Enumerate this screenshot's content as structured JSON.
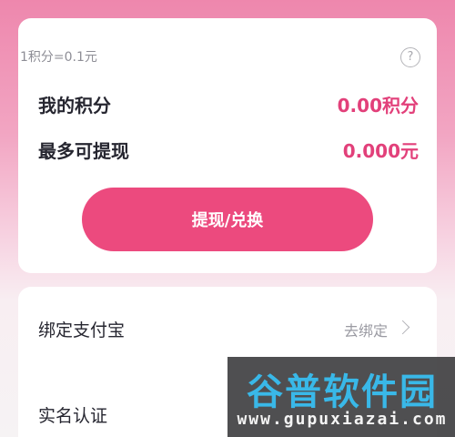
{
  "points_card": {
    "rate_text": "1积分=0.1元",
    "help_icon_glyph": "?",
    "my_points": {
      "label": "我的积分",
      "value": "0.00积分"
    },
    "max_withdraw": {
      "label": "最多可提现",
      "value": "0.000元"
    },
    "withdraw_button_label": "提现/兑换"
  },
  "settings": {
    "alipay": {
      "label": "绑定支付宝",
      "action": "去绑定"
    },
    "realname": {
      "label": "实名认证"
    }
  },
  "watermark": {
    "logo": "谷普软件园",
    "url": "www.gupuxiazai.com"
  },
  "colors": {
    "accent": "#ec4a7e",
    "value_text": "#e2407a"
  }
}
